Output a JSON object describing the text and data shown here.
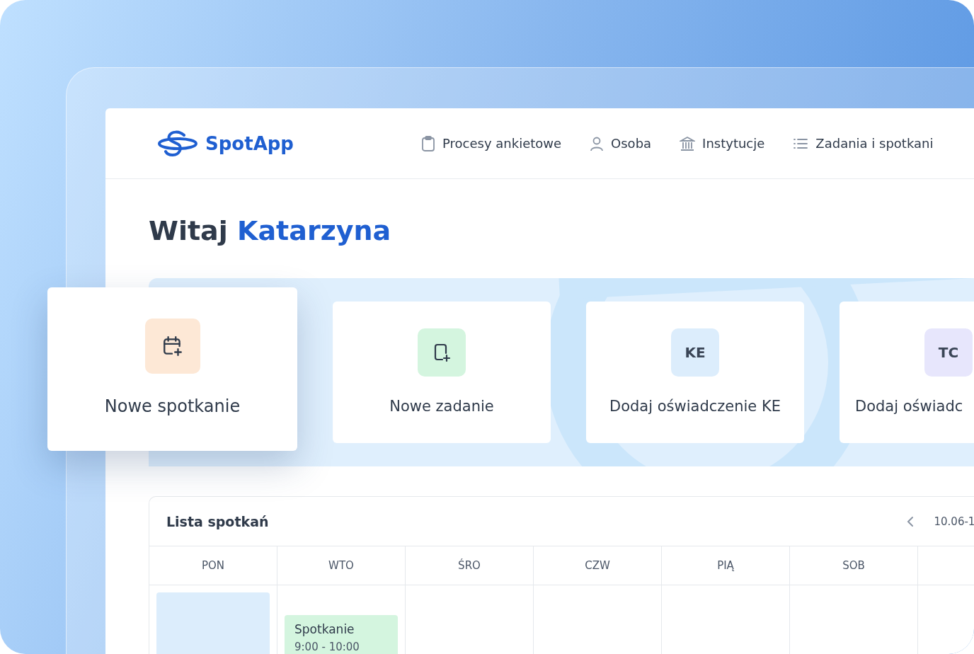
{
  "brand": {
    "name": "SpotApp"
  },
  "nav": [
    {
      "label": "Procesy ankietowe"
    },
    {
      "label": "Osoba"
    },
    {
      "label": "Instytucje"
    },
    {
      "label": "Zadania i spotkani"
    }
  ],
  "greeting": {
    "text": "Witaj",
    "name": "Katarzyna"
  },
  "tiles": [
    {
      "label": "Nowe spotkanie",
      "kind": "icon",
      "color": "#fde8d6"
    },
    {
      "label": "Nowe zadanie",
      "kind": "icon",
      "color": "#d4f5df"
    },
    {
      "label": "Dodaj oświadczenie KE",
      "kind": "badge",
      "badge": "KE",
      "color": "#dcedfc"
    },
    {
      "label": "Dodaj oświadc",
      "kind": "badge",
      "badge": "TC",
      "color": "#e7e6fc"
    }
  ],
  "calendar": {
    "title": "Lista spotkań",
    "range": "10.06-1",
    "days": [
      {
        "label": "PON",
        "events": [
          {
            "color": "#dcedfc"
          }
        ]
      },
      {
        "label": "WTO",
        "events": [
          {
            "title": "Spotkanie",
            "time": "9:00 - 10:00",
            "color": "#d4f5df"
          }
        ]
      },
      {
        "label": "ŚRO"
      },
      {
        "label": "CZW"
      },
      {
        "label": "PIĄ"
      },
      {
        "label": "SOB"
      }
    ]
  }
}
